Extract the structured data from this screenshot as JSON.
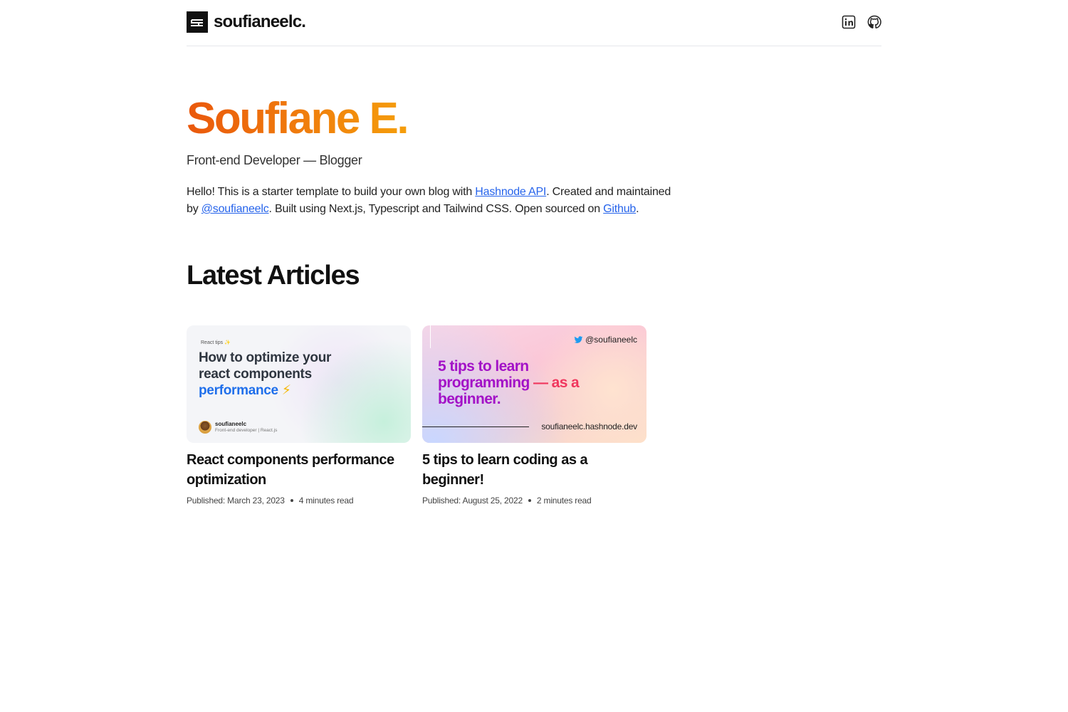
{
  "header": {
    "brand_name": "soufianeelc.",
    "logo_icon": "se-monogram-logo",
    "social": [
      {
        "name": "linkedin-icon"
      },
      {
        "name": "github-icon"
      }
    ]
  },
  "hero": {
    "title": "Soufiane E.",
    "subtitle": "Front-end Developer — Blogger",
    "desc_part1": "Hello! This is a starter template to build your own blog with ",
    "link_hashnode": "Hashnode API",
    "desc_part2": ". Created and maintained by ",
    "link_author": "@soufianeelc",
    "desc_part3": ". Built using Next.js, Typescript and Tailwind CSS. Open sourced on ",
    "link_github": "Github",
    "desc_part4": "."
  },
  "section": {
    "title": "Latest Articles"
  },
  "articles": [
    {
      "thumb": {
        "tag": "React tips ✨",
        "title_line1": "How to optimize your",
        "title_line2": "react components",
        "title_highlight": "performance",
        "title_emoji": "⚡",
        "author_name": "soufianeelc",
        "author_role": "Front-end developer | React.js"
      },
      "title": "React components performance optimization",
      "published": "Published: March 23, 2023",
      "read_time": "4 minutes read"
    },
    {
      "thumb": {
        "handle": "@soufianeelc",
        "title_line1": "5 tips to learn",
        "title_line2a": "programming",
        "title_line2b": " — as a",
        "title_line3": "beginner.",
        "url": "soufianeelc.hashnode.dev"
      },
      "title": "5 tips to learn coding as a beginner!",
      "published": "Published: August 25, 2022",
      "read_time": "2 minutes read"
    }
  ],
  "colors": {
    "accent_start": "#ea580c",
    "accent_end": "#f59e0b",
    "link": "#2563eb"
  }
}
